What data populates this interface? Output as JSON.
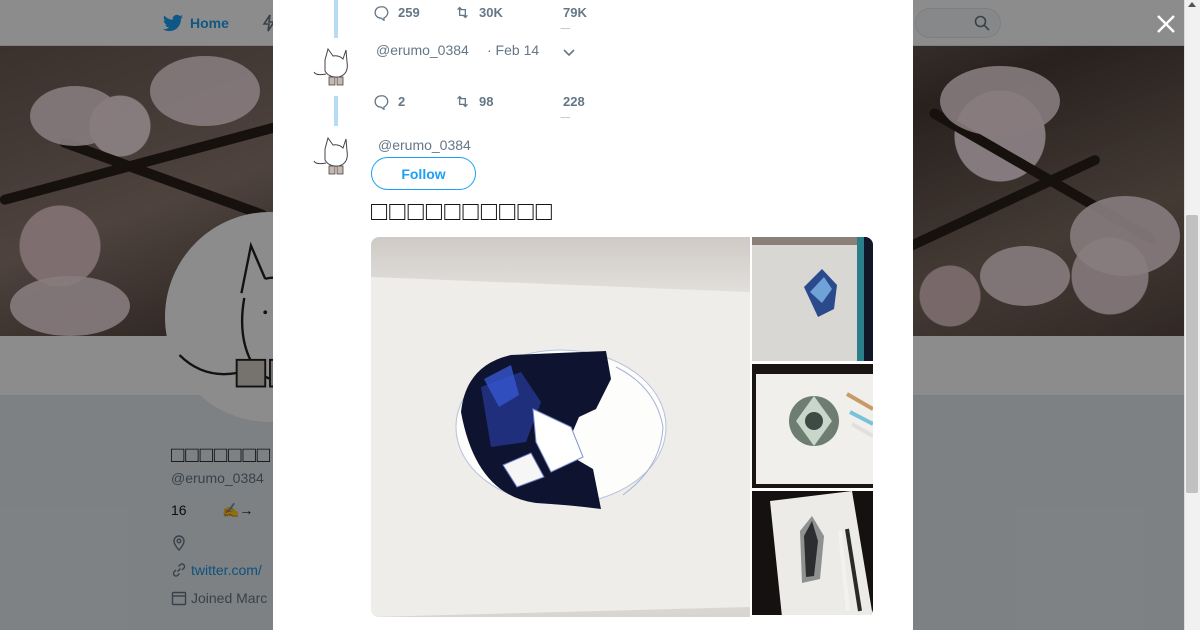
{
  "nav": {
    "home_label": "Home"
  },
  "profile": {
    "name": "□□□□□□□",
    "handle": "@erumo_0384",
    "count": "16",
    "bio_preview": "✍️→",
    "link": "twitter.com/",
    "joined": "Joined Marc"
  },
  "tweets": [
    {
      "handle": "",
      "date": "",
      "replies": "259",
      "retweets": "30K",
      "likes": "79K"
    },
    {
      "handle": "@erumo_0384",
      "date": "· Feb 14",
      "replies": "2",
      "retweets": "98",
      "likes": "228"
    }
  ],
  "main_tweet": {
    "handle": "@erumo_0384",
    "follow_label": "Follow",
    "text": "□□□□□□□□□□",
    "media": [
      {
        "subject": "blue gem drawing, large"
      },
      {
        "subject": "blue gem drawing with pencils"
      },
      {
        "subject": "round diamond drawing"
      },
      {
        "subject": "quartz crystal drawing"
      }
    ]
  },
  "colors": {
    "accent": "#1da1f2",
    "thread_line": "#b5dcf7",
    "muted_text": "#657786"
  },
  "icons": {
    "reply": "reply-icon",
    "retweet": "retweet-icon",
    "like": "heart-icon",
    "close": "close-icon",
    "caret": "chevron-down-icon"
  }
}
